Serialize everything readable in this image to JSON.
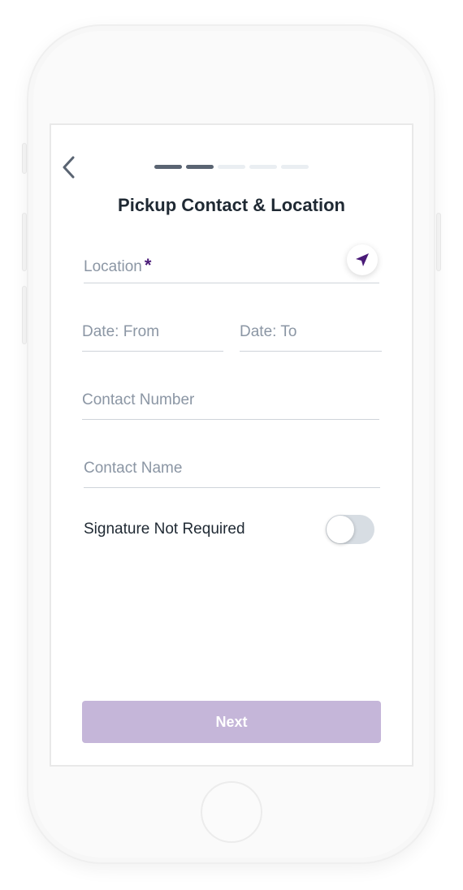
{
  "header": {
    "back_icon": "chevron-left-icon",
    "steps": {
      "total": 5,
      "completed": 2
    },
    "title": "Pickup Contact & Location"
  },
  "form": {
    "location": {
      "label": "Location",
      "required_marker": "*",
      "locate_icon": "navigation-arrow-icon"
    },
    "date_from": {
      "label": "Date: From"
    },
    "date_to": {
      "label": "Date: To"
    },
    "contact_number": {
      "label": "Contact Number"
    },
    "contact_name": {
      "label": "Contact Name"
    },
    "signature": {
      "label": "Signature Not Required",
      "enabled": false
    }
  },
  "footer": {
    "next_label": "Next"
  },
  "colors": {
    "accent": "#4a1b78",
    "button_disabled": "#c5b6d9",
    "step_active": "#5a6472",
    "step_inactive": "#eaeef2",
    "placeholder": "#8b96a4",
    "text": "#1f2933"
  }
}
